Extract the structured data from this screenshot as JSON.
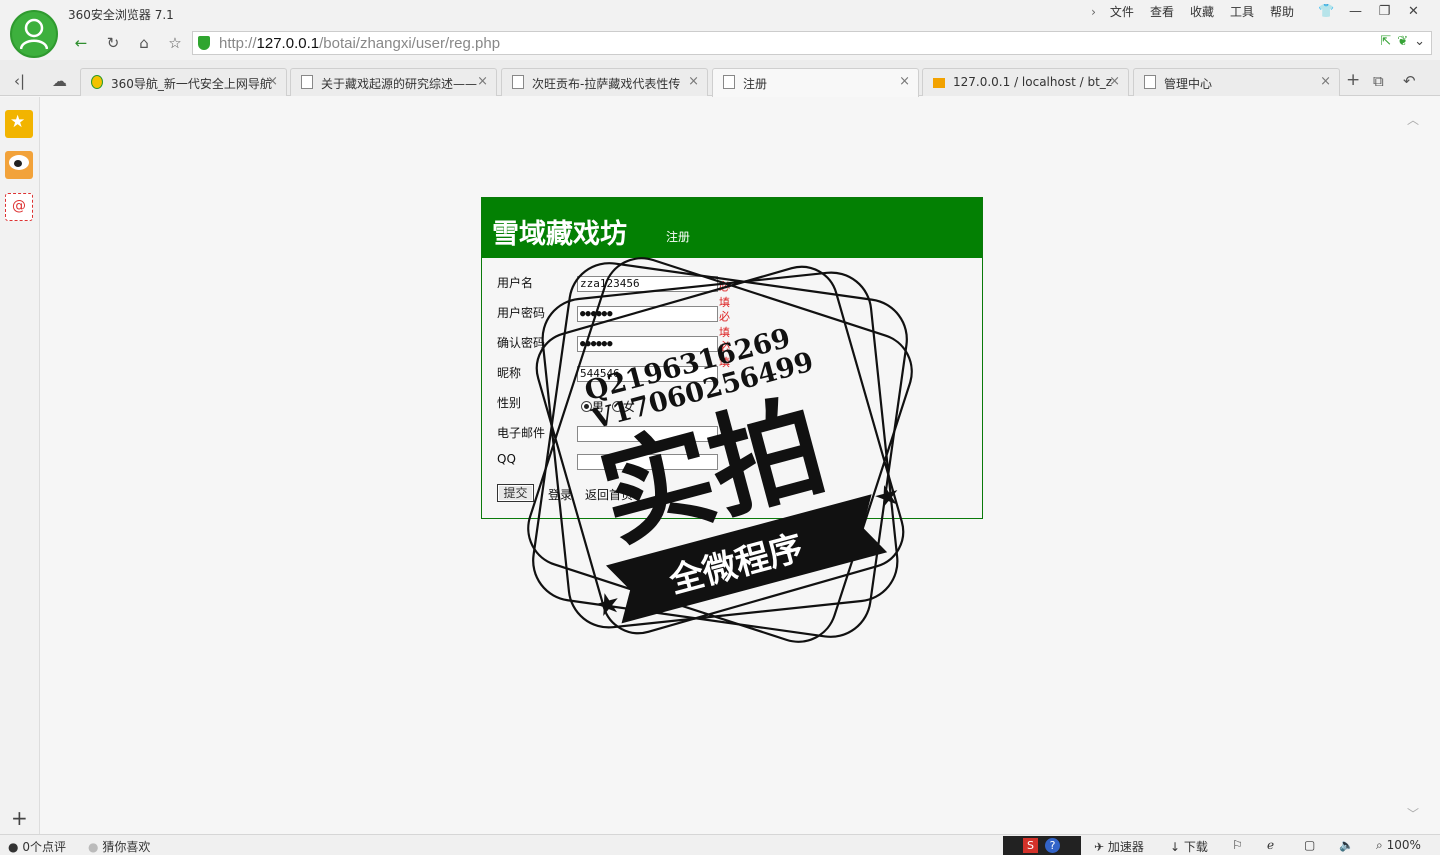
{
  "browser": {
    "app_title": "360安全浏览器 7.1",
    "menu": [
      "文件",
      "查看",
      "收藏",
      "工具",
      "帮助"
    ],
    "window_controls": [
      "shirt-icon",
      "minimize-icon",
      "restore-icon",
      "close-icon"
    ]
  },
  "nav": {
    "url_prefix": "http://",
    "url_host": "127.0.0.1",
    "url_path": "/botai/zhangxi/user/reg.php"
  },
  "tabs": [
    {
      "label": "360导航_新一代安全上网导航",
      "active": false
    },
    {
      "label": "关于藏戏起源的研究综述——",
      "active": false
    },
    {
      "label": "次旺贡布-拉萨藏戏代表性传",
      "active": false
    },
    {
      "label": "注册",
      "active": true
    },
    {
      "label": "127.0.0.1 / localhost / bt_z",
      "active": false
    },
    {
      "label": "管理中心",
      "active": false
    }
  ],
  "page": {
    "site_title": "雪域藏戏坊",
    "subtitle": "注册",
    "fields": [
      {
        "label": "用户名",
        "value": "zza123456",
        "required": "必填"
      },
      {
        "label": "用户密码",
        "value": "●●●●●●",
        "required": "必填"
      },
      {
        "label": "确认密码",
        "value": "●●●●●●",
        "required": "必填"
      },
      {
        "label": "昵称",
        "value": "544546",
        "required": ""
      },
      {
        "label": "性别",
        "value": "",
        "required": ""
      },
      {
        "label": "电子邮件",
        "value": "",
        "required": ""
      },
      {
        "label": "QQ",
        "value": "",
        "required": ""
      }
    ],
    "gender_options": [
      "男",
      "女"
    ],
    "gender_selected": "男",
    "submit_label": "提交",
    "login_link": "登录",
    "home_link": "返回首页"
  },
  "watermark": {
    "line1": "Q2196316269",
    "line2": "V17060256499",
    "main_text": "实拍",
    "banner_text": "全微程序"
  },
  "status": {
    "comments": "0个点评",
    "guess": "猜你喜欢",
    "accelerator": "加速器",
    "download": "下载",
    "zoom": "100%"
  }
}
